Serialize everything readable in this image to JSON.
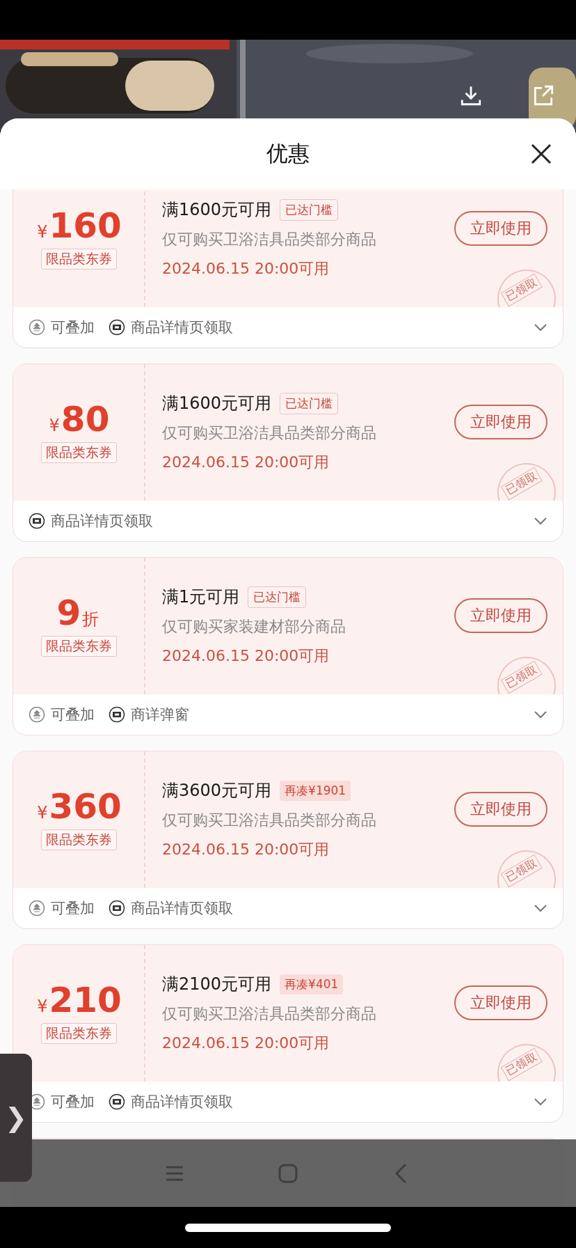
{
  "sheet": {
    "title": "优惠"
  },
  "coupons": [
    {
      "amount": {
        "kind": "money",
        "symbol": "¥",
        "value": "160"
      },
      "label": "限品类东券",
      "heading": "满1600元可用",
      "threshold": {
        "kind": "reached",
        "text": "已达门槛"
      },
      "scope": "仅可购买卫浴洁具品类部分商品",
      "time": "2024.06.15 20:00可用",
      "action": "立即使用",
      "stamp": "已领取",
      "footer": [
        {
          "kind": "stackable",
          "text": "可叠加"
        },
        {
          "kind": "source",
          "text": "商品详情页领取"
        }
      ]
    },
    {
      "amount": {
        "kind": "money",
        "symbol": "¥",
        "value": "80"
      },
      "label": "限品类东券",
      "heading": "满1600元可用",
      "threshold": {
        "kind": "reached",
        "text": "已达门槛"
      },
      "scope": "仅可购买卫浴洁具品类部分商品",
      "time": "2024.06.15 20:00可用",
      "action": "立即使用",
      "stamp": "已领取",
      "footer": [
        {
          "kind": "source",
          "text": "商品详情页领取"
        }
      ]
    },
    {
      "amount": {
        "kind": "discount",
        "value": "9",
        "unit": "折"
      },
      "label": "限品类东券",
      "heading": "满1元可用",
      "threshold": {
        "kind": "reached",
        "text": "已达门槛"
      },
      "scope": "仅可购买家装建材部分商品",
      "time": "2024.06.15 20:00可用",
      "action": "立即使用",
      "stamp": "已领取",
      "footer": [
        {
          "kind": "stackable",
          "text": "可叠加"
        },
        {
          "kind": "source",
          "text": "商详弹窗"
        }
      ]
    },
    {
      "amount": {
        "kind": "money",
        "symbol": "¥",
        "value": "360"
      },
      "label": "限品类东券",
      "heading": "满3600元可用",
      "threshold": {
        "kind": "short",
        "text": "再凑¥1901"
      },
      "scope": "仅可购买卫浴洁具品类部分商品",
      "time": "2024.06.15 20:00可用",
      "action": "立即使用",
      "stamp": "已领取",
      "footer": [
        {
          "kind": "stackable",
          "text": "可叠加"
        },
        {
          "kind": "source",
          "text": "商品详情页领取"
        }
      ]
    },
    {
      "amount": {
        "kind": "money",
        "symbol": "¥",
        "value": "210"
      },
      "label": "限品类东券",
      "heading": "满2100元可用",
      "threshold": {
        "kind": "short",
        "text": "再凑¥401"
      },
      "scope": "仅可购买卫浴洁具品类部分商品",
      "time": "2024.06.15 20:00可用",
      "action": "立即使用",
      "stamp": "已领取",
      "footer": [
        {
          "kind": "stackable",
          "text": "可叠加"
        },
        {
          "kind": "source",
          "text": "商品详情页领取"
        }
      ]
    }
  ],
  "side_tab": {
    "glyph": "❯"
  }
}
